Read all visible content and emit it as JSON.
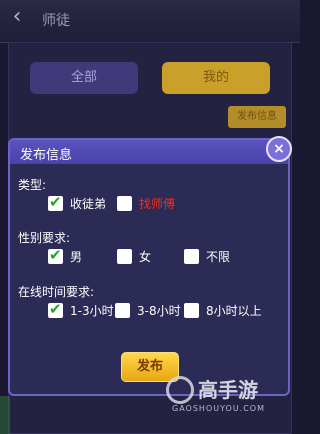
{
  "background": {
    "title": "师徒",
    "tabs": [
      {
        "label": "全部"
      },
      {
        "label": "我的"
      }
    ],
    "publish_info_button": "发布信息"
  },
  "dialog": {
    "title": "发布信息",
    "close_symbol": "×",
    "sections": {
      "type": {
        "label": "类型:",
        "options": [
          {
            "label": "收徒弟",
            "checked": true
          },
          {
            "label": "找师傅",
            "checked": false
          }
        ]
      },
      "gender": {
        "label": "性别要求:",
        "options": [
          {
            "label": "男",
            "checked": true
          },
          {
            "label": "女",
            "checked": false
          },
          {
            "label": "不限",
            "checked": false
          }
        ]
      },
      "online": {
        "label": "在线时间要求:",
        "options": [
          {
            "label": "1-3小时",
            "checked": true
          },
          {
            "label": "3-8小时",
            "checked": false
          },
          {
            "label": "8小时以上",
            "checked": false
          }
        ]
      }
    },
    "publish_button": "发布"
  },
  "watermark": {
    "text": "高手游",
    "sub": "GAOSHOUYOU.COM"
  },
  "colors": {
    "accent": "#6c63c9",
    "publish": "#f0b821",
    "red_label": "#e0342a",
    "check": "#2aa12a"
  }
}
